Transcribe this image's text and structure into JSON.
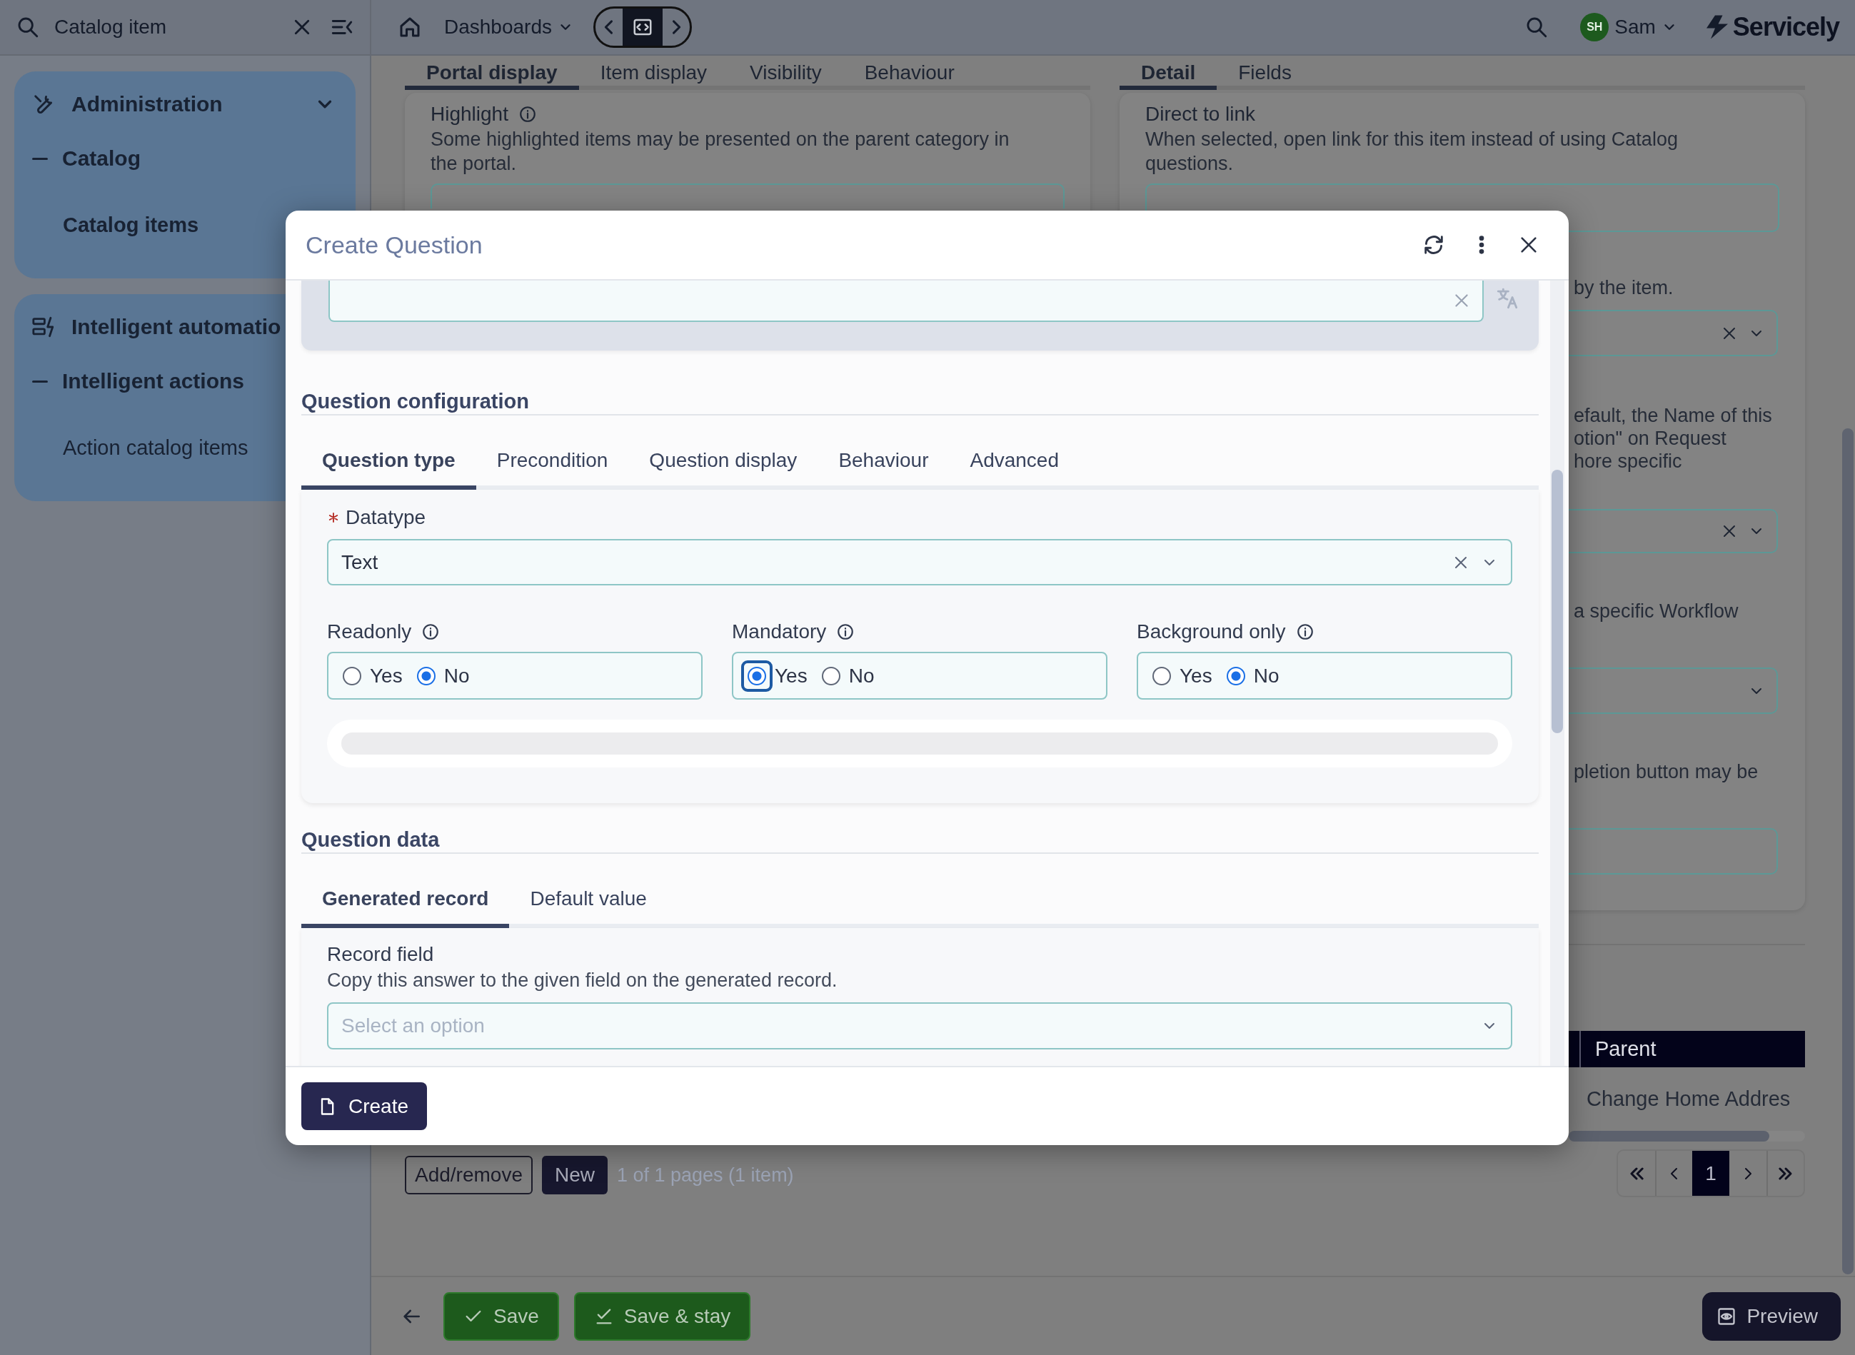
{
  "topbar": {
    "search": {
      "value": "Catalog item"
    },
    "menu": "Dashboards",
    "user": {
      "initials": "SH",
      "name": "Sam"
    },
    "brand": "Servicely"
  },
  "sidebar": {
    "groups": [
      {
        "title": "Administration",
        "expanded": true,
        "items": [
          {
            "label": "Catalog",
            "children": [
              {
                "label": "Catalog items",
                "selected": true
              }
            ]
          }
        ]
      },
      {
        "title": "Intelligent automatio",
        "items": [
          {
            "label": "Intelligent actions",
            "children": [
              {
                "label": "Action catalog items",
                "selected": false
              }
            ]
          }
        ]
      }
    ]
  },
  "page": {
    "left_tabs": [
      {
        "label": "Portal display",
        "selected": true
      },
      {
        "label": "Item display",
        "selected": false
      },
      {
        "label": "Visibility",
        "selected": false
      },
      {
        "label": "Behaviour",
        "selected": false
      }
    ],
    "right_tabs": [
      {
        "label": "Detail",
        "selected": true
      },
      {
        "label": "Fields",
        "selected": false
      }
    ],
    "highlight": {
      "label": "Highlight",
      "description": "Some highlighted items may be presented on the parent category in the portal."
    },
    "direct_link": {
      "label": "Direct to link",
      "description": "When selected, open link for this item instead of using Catalog questions."
    },
    "fragments": [
      {
        "kind": "text",
        "lines": [
          "by the item."
        ]
      },
      {
        "kind": "select",
        "clearable": true
      },
      {
        "kind": "text",
        "lines": [
          "efault, the Name of this",
          "otion\" on Request",
          "hore specific"
        ]
      },
      {
        "kind": "select",
        "clearable": true
      },
      {
        "kind": "text",
        "lines": [
          "a specific Workflow"
        ]
      },
      {
        "kind": "select",
        "clearable": false
      },
      {
        "kind": "text",
        "lines": [
          "pletion button may be"
        ]
      },
      {
        "kind": "input"
      }
    ],
    "table": {
      "columns": [
        "Parent"
      ],
      "rows": [
        [
          "Change Home Addres"
        ]
      ]
    },
    "list_buttons": [
      {
        "label": "Add/remove",
        "kind": "outline"
      },
      {
        "label": "New",
        "kind": "solid"
      }
    ],
    "page_info": "1 of 1 pages (1 item)",
    "pages": [
      {
        "label": "1",
        "selected": true
      }
    ],
    "actions": [
      {
        "label": "Save",
        "kind": "confirm"
      },
      {
        "label": "Save & stay",
        "kind": "confirm_stay"
      },
      {
        "label": "Preview",
        "kind": "preview"
      }
    ]
  },
  "modal": {
    "title": "Create Question",
    "config": {
      "title": "Question configuration",
      "tabs": [
        {
          "label": "Question type",
          "selected": true
        },
        {
          "label": "Precondition",
          "selected": false
        },
        {
          "label": "Question display",
          "selected": false
        },
        {
          "label": "Behaviour",
          "selected": false
        },
        {
          "label": "Advanced",
          "selected": false
        }
      ],
      "datatype": {
        "label": "Datatype",
        "required": true,
        "value": "Text"
      },
      "toggles": [
        {
          "label": "Readonly",
          "options": [
            {
              "label": "Yes",
              "selected": false,
              "focused": false
            },
            {
              "label": "No",
              "selected": true,
              "focused": false
            }
          ]
        },
        {
          "label": "Mandatory",
          "options": [
            {
              "label": "Yes",
              "selected": true,
              "focused": true
            },
            {
              "label": "No",
              "selected": false,
              "focused": false
            }
          ]
        },
        {
          "label": "Background only",
          "options": [
            {
              "label": "Yes",
              "selected": false,
              "focused": false
            },
            {
              "label": "No",
              "selected": true,
              "focused": false
            }
          ]
        }
      ]
    },
    "data": {
      "title": "Question data",
      "tabs": [
        {
          "label": "Generated record",
          "selected": true
        },
        {
          "label": "Default value",
          "selected": false
        }
      ],
      "field": {
        "label": "Record field",
        "description": "Copy this answer to the given field on the generated record.",
        "placeholder": "Select an option"
      }
    },
    "create": "Create"
  }
}
